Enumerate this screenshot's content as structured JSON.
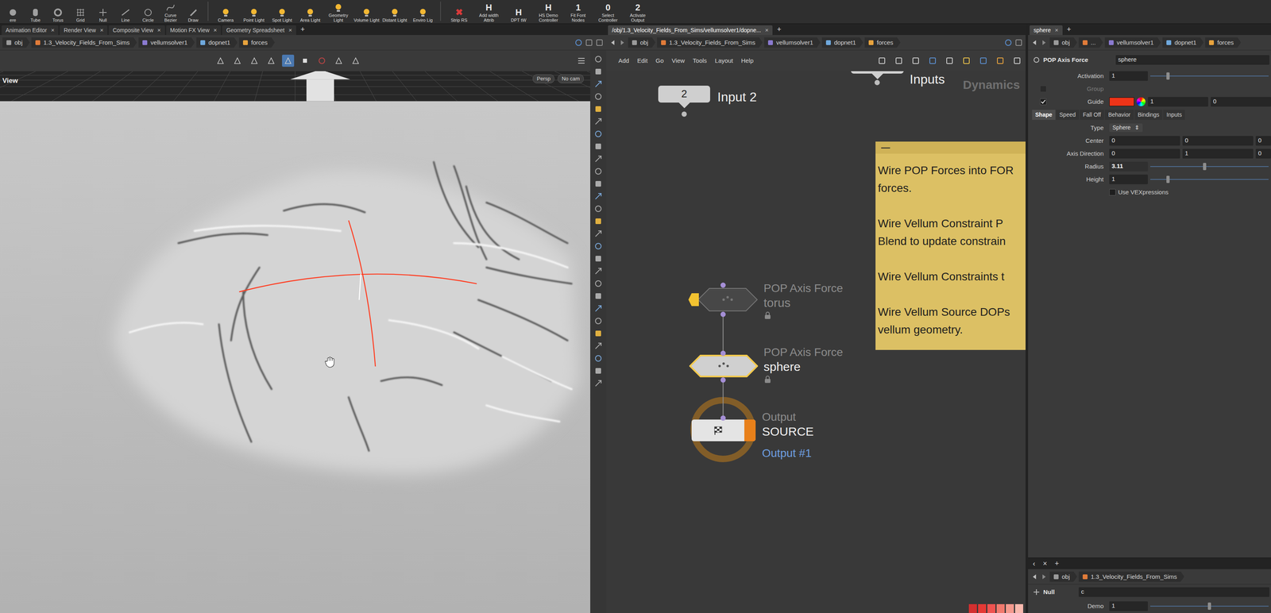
{
  "shelf": {
    "tools": [
      {
        "label": "ere",
        "kind": "geo"
      },
      {
        "label": "Tube",
        "kind": "geo"
      },
      {
        "label": "Torus",
        "kind": "geo"
      },
      {
        "label": "Grid",
        "kind": "geo"
      },
      {
        "label": "Null",
        "kind": "geo"
      },
      {
        "label": "Line",
        "kind": "geo"
      },
      {
        "label": "Circle",
        "kind": "geo"
      },
      {
        "label": "Curve Bezier",
        "kind": "geo"
      },
      {
        "label": "Draw",
        "kind": "geo"
      },
      {
        "label": "Camera",
        "kind": "light"
      },
      {
        "label": "Point Light",
        "kind": "light"
      },
      {
        "label": "Spot Light",
        "kind": "light"
      },
      {
        "label": "Area Light",
        "kind": "light"
      },
      {
        "label": "Geometry Light",
        "kind": "light"
      },
      {
        "label": "Volume Light",
        "kind": "light"
      },
      {
        "label": "Distant Light",
        "kind": "light"
      },
      {
        "label": "Enviro Lig",
        "kind": "light"
      },
      {
        "label": "Strip RS",
        "kind": "glyph",
        "glyph": "✖",
        "color": "#d93a3a"
      },
      {
        "label": "Add width Attrib",
        "kind": "glyph",
        "glyph": "H",
        "color": "#e8e8e8"
      },
      {
        "label": "DPT tW",
        "kind": "glyph",
        "glyph": "H",
        "color": "#e8e8e8"
      },
      {
        "label": "HS Demo Controller",
        "kind": "glyph",
        "glyph": "H",
        "color": "#e8e8e8"
      },
      {
        "label": "Fit Font Nodes",
        "kind": "glyph",
        "glyph": "1",
        "color": "#e8e8e8"
      },
      {
        "label": "Select Controller",
        "kind": "glyph",
        "glyph": "0",
        "color": "#e8e8e8"
      },
      {
        "label": "Activate Output",
        "kind": "glyph",
        "glyph": "2",
        "color": "#e8e8e8"
      }
    ]
  },
  "viewer": {
    "tabs": [
      {
        "label": "Animation Editor",
        "selected": false
      },
      {
        "label": "Render View",
        "selected": false
      },
      {
        "label": "Composite View",
        "selected": false
      },
      {
        "label": "Motion FX View",
        "selected": false
      },
      {
        "label": "Geometry Spreadsheet",
        "selected": false
      }
    ],
    "close": "×",
    "add": "+",
    "path": [
      "obj",
      "1.3_Velocity_Fields_From_Sims",
      "vellumsolver1",
      "dopnet1",
      "forces"
    ],
    "viewport": {
      "label": "View",
      "projection": "Persp",
      "camera": "No cam"
    }
  },
  "network": {
    "tab": "/obj/1.3_Velocity_Fields_From_Sims/vellumsolver1/dopne...",
    "close": "×",
    "add": "+",
    "path": [
      "obj",
      "1.3_Velocity_Fields_From_Sims",
      "vellumsolver1",
      "dopnet1",
      "forces"
    ],
    "menu": [
      "Add",
      "Edit",
      "Go",
      "View",
      "Tools",
      "Layout",
      "Help"
    ],
    "context": "Dynamics",
    "nodes": [
      {
        "kind": "input",
        "label": "Inputs"
      },
      {
        "kind": "input",
        "badge": "2",
        "label": "Input 2"
      },
      {
        "kind": "pop",
        "type": "POP Axis Force",
        "label": "torus",
        "bypassed": true,
        "selected": false
      },
      {
        "kind": "pop",
        "type": "POP Axis Force",
        "label": "sphere",
        "bypassed": false,
        "selected": true
      },
      {
        "kind": "output",
        "type": "Output",
        "label": "SOURCE",
        "sub": "Output #1",
        "display": true
      }
    ],
    "note": {
      "collapse": "—",
      "paragraphs": [
        [
          "Wire POP Forces into FOR",
          "forces."
        ],
        [
          "Wire Vellum Constraint P",
          "Blend to update constrain"
        ],
        [
          "Wire Vellum Constraints t"
        ],
        [
          "Wire Vellum Source DOPs",
          "vellum geometry."
        ]
      ]
    },
    "palette": [
      {
        "color": "#d32f2f"
      },
      {
        "color": "#e53935"
      },
      {
        "color": "#ef5350"
      },
      {
        "color": "#f27a6e"
      },
      {
        "color": "#f59a8e"
      },
      {
        "color": "#f8b9ae"
      }
    ]
  },
  "parameters": {
    "tab": "sphere",
    "close": "×",
    "add": "+",
    "path": [
      "obj",
      "...",
      "vellumsolver1",
      "dopnet1",
      "forces"
    ],
    "node_type": "POP Axis Force",
    "node_name": "sphere",
    "header_rows": [
      {
        "kind": "slider",
        "label": "Activation",
        "value": "1",
        "level": 0.15,
        "highlighted": false
      },
      {
        "kind": "toggle-field",
        "label": "Group",
        "checked": false,
        "disabled": true
      },
      {
        "kind": "color",
        "label": "Guide",
        "checked": true,
        "color": "#ee3418",
        "values": [
          "1",
          "0"
        ]
      }
    ],
    "tabs": [
      {
        "label": "Shape",
        "selected": true
      },
      {
        "label": "Speed",
        "selected": false
      },
      {
        "label": "Fall Off",
        "selected": false
      },
      {
        "label": "Behavior",
        "selected": false
      },
      {
        "label": "Bindings",
        "selected": false
      },
      {
        "label": "Inputs",
        "selected": false
      }
    ],
    "rows": [
      {
        "kind": "menu",
        "label": "Type",
        "value": "Sphere",
        "glyph": "⇕"
      },
      {
        "kind": "vector",
        "label": "Center",
        "values": [
          "0",
          "0",
          "0"
        ]
      },
      {
        "kind": "vector",
        "label": "Axis Direction",
        "values": [
          "0",
          "1",
          "0"
        ]
      },
      {
        "kind": "slider",
        "label": "Radius",
        "value": "3.11",
        "level": 0.46,
        "highlighted": true
      },
      {
        "kind": "slider",
        "label": "Height",
        "value": "1",
        "level": 0.15,
        "highlighted": false
      },
      {
        "kind": "checkbox",
        "label": "Use VEXpressions",
        "checked": false
      }
    ]
  },
  "bottom": {
    "back": "‹",
    "close": "×",
    "add": "+",
    "path": [
      "obj",
      "1.3_Velocity_Fields_From_Sims"
    ],
    "node_type": "Null",
    "node_name": "c",
    "rows": [
      {
        "label": "Demo",
        "value": "1",
        "level": 0.5
      }
    ]
  }
}
